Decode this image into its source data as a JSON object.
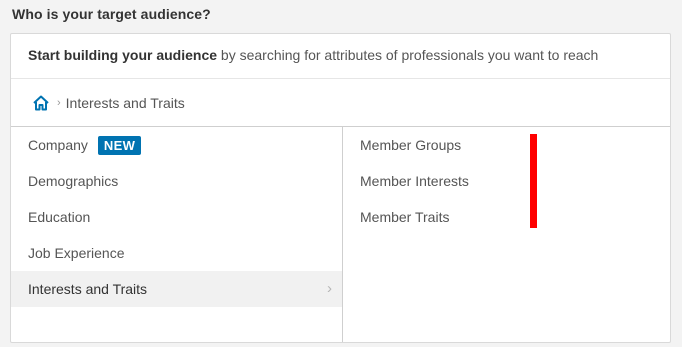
{
  "heading": "Who is your target audience?",
  "intro": {
    "bold": "Start building your audience",
    "rest": " by searching for attributes of professionals you want to reach"
  },
  "breadcrumb": {
    "home_icon": "home-icon",
    "separator_icon": "chevron-right-icon",
    "current": "Interests and Traits"
  },
  "categories": [
    {
      "label": "Company",
      "badge": "NEW"
    },
    {
      "label": "Demographics"
    },
    {
      "label": "Education"
    },
    {
      "label": "Job Experience"
    },
    {
      "label": "Interests and Traits",
      "selected": true
    }
  ],
  "subcategories": [
    {
      "label": "Member Groups"
    },
    {
      "label": "Member Interests"
    },
    {
      "label": "Member Traits"
    }
  ],
  "colors": {
    "accent": "#0073b1",
    "marker": "#ff0000"
  }
}
